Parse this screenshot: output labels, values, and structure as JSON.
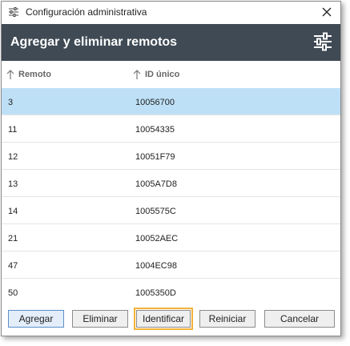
{
  "window": {
    "title": "Configuración administrativa",
    "app_icon": "sliders-icon",
    "close_icon": "close-icon"
  },
  "header": {
    "title": "Agregar y eliminar remotos",
    "settings_icon": "sliders-icon"
  },
  "table": {
    "columns": [
      {
        "label": "Remoto",
        "sort_icon": "sort-up-arrow-icon"
      },
      {
        "label": "ID único",
        "sort_icon": "sort-up-arrow-icon"
      }
    ],
    "rows": [
      {
        "remoto": "3",
        "id": "10056700",
        "selected": true
      },
      {
        "remoto": "11",
        "id": "10054335",
        "selected": false
      },
      {
        "remoto": "12",
        "id": "10051F79",
        "selected": false
      },
      {
        "remoto": "13",
        "id": "1005A7D8",
        "selected": false
      },
      {
        "remoto": "14",
        "id": "1005575C",
        "selected": false
      },
      {
        "remoto": "21",
        "id": "10052AEC",
        "selected": false
      },
      {
        "remoto": "47",
        "id": "1004EC98",
        "selected": false
      },
      {
        "remoto": "50",
        "id": "1005350D",
        "selected": false
      }
    ]
  },
  "buttons": {
    "add": "Agregar",
    "remove": "Eliminar",
    "identify": "Identificar",
    "reset": "Reiniciar",
    "cancel": "Cancelar"
  },
  "colors": {
    "header_bg": "#3f4a55",
    "selected_row": "#bee0f7",
    "focus_outline": "#f2b23a"
  }
}
